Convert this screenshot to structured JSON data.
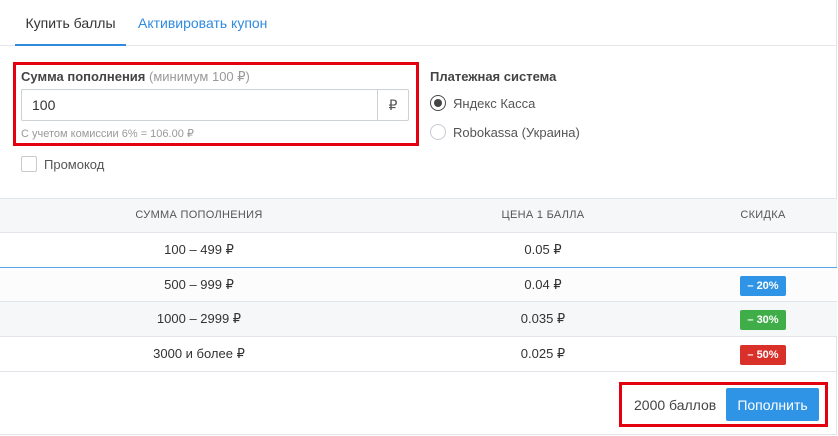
{
  "tabs": [
    {
      "label": "Купить баллы",
      "active": true
    },
    {
      "label": "Активировать купон",
      "active": false
    }
  ],
  "amount": {
    "label": "Сумма пополнения",
    "hint": "(минимум 100 ₽)",
    "value": "100",
    "currency": "₽",
    "commission_note": "С учетом комиссии 6% = 106.00 ₽"
  },
  "promo": {
    "label": "Промокод",
    "checked": false
  },
  "payment": {
    "title": "Платежная система",
    "options": [
      {
        "label": "Яндекс Касса",
        "selected": true
      },
      {
        "label": "Robokassa (Украина)",
        "selected": false
      }
    ]
  },
  "pricing_table": {
    "headers": [
      "СУММА ПОПОЛНЕНИЯ",
      "ЦЕНА 1 БАЛЛА",
      "СКИДКА"
    ],
    "rows": [
      {
        "range": "100 – 499 ₽",
        "price": "0.05 ₽",
        "discount": ""
      },
      {
        "range": "500 – 999 ₽",
        "price": "0.04 ₽",
        "discount": "– 20%",
        "discount_color": "#2f93e6"
      },
      {
        "range": "1000 – 2999 ₽",
        "price": "0.035 ₽",
        "discount": "– 30%",
        "discount_color": "#3fae49"
      },
      {
        "range": "3000 и более ₽",
        "price": "0.025 ₽",
        "discount": "– 50%",
        "discount_color": "#d9302a"
      }
    ]
  },
  "footer": {
    "points": "2000 баллов",
    "submit_label": "Пополнить"
  },
  "colors": {
    "accent": "#2f93e6",
    "highlight_box": "#e3000f"
  }
}
